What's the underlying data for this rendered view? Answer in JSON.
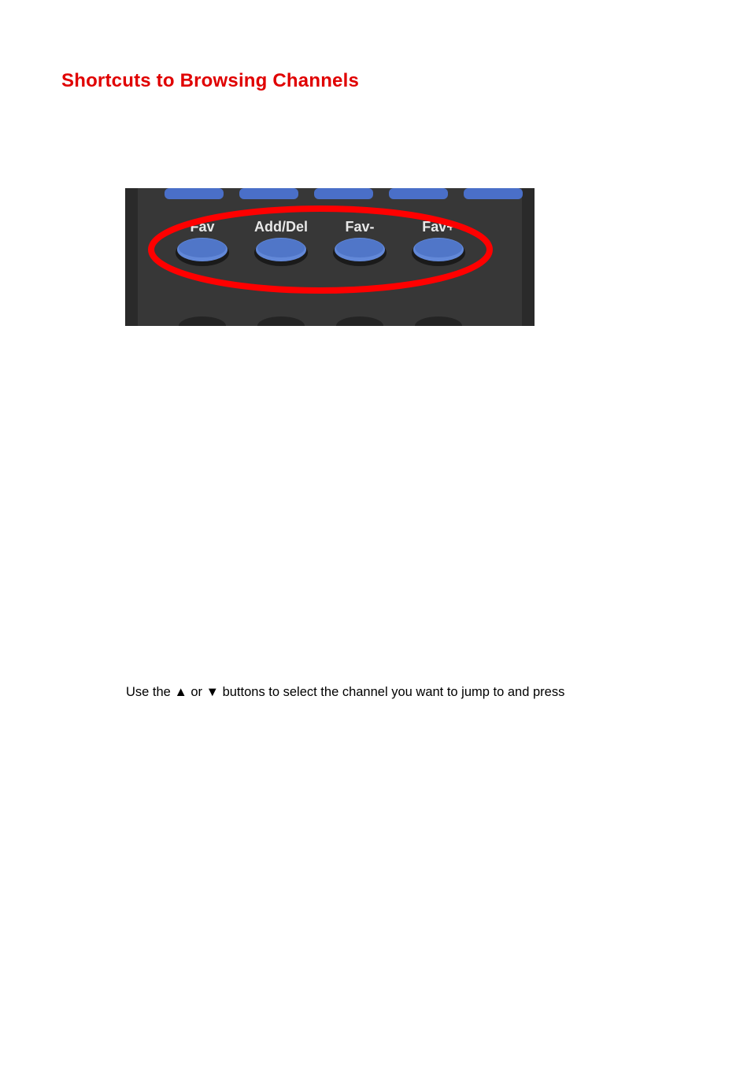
{
  "heading": "Shortcuts to Browsing Channels",
  "remote": {
    "buttons": [
      {
        "label": "Fav"
      },
      {
        "label": "Add/Del"
      },
      {
        "label": "Fav-"
      },
      {
        "label": "Fav+"
      }
    ]
  },
  "instruction": {
    "prefix": "Use the ",
    "up_symbol": "▲",
    "mid": " or ",
    "down_symbol": "▼",
    "suffix": " buttons to select the channel you want to jump to and press"
  }
}
